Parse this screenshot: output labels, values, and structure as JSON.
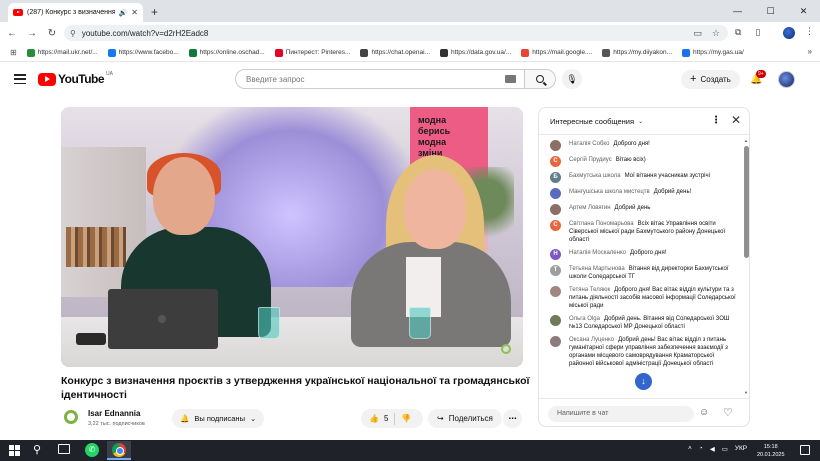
{
  "browser": {
    "tab_title": "(287) Конкурс з визначення...",
    "url": "youtube.com/watch?v=d2rH2Eadc8",
    "bookmarks": [
      {
        "label": "https://mail.ukr.net/...",
        "color": "#2a8c3a"
      },
      {
        "label": "https://www.facebo...",
        "color": "#1877f2"
      },
      {
        "label": "https://online.oschad...",
        "color": "#0b7a3a"
      },
      {
        "label": "Пинтерест: Pinteres...",
        "color": "#e60023"
      },
      {
        "label": "https://chat.openai...",
        "color": "#444444"
      },
      {
        "label": "https://data.gov.ua/...",
        "color": "#333333"
      },
      {
        "label": "https://mail.google....",
        "color": "#ea4335"
      },
      {
        "label": "https://my.diiyakon...",
        "color": "#555555"
      },
      {
        "label": "https://my.gas.ua/",
        "color": "#1a73e8"
      }
    ],
    "more_bookmarks": "»"
  },
  "youtube": {
    "logo_text": "YouTube",
    "region": "UA",
    "search_placeholder": "Введите запрос",
    "create_label": "Создать",
    "notif_badge": "9+"
  },
  "video": {
    "poster_lines": [
      "модна",
      "берись",
      "",
      "модна",
      "зміни"
    ],
    "title": "Конкурс з визначення проєктів з утвердження української національної та громадянської ідентичності",
    "channel_name": "Isar Ednannia",
    "channel_subs": "3,22 тыс. подписчиков",
    "subscribed_label": "Вы подписаны",
    "likes": "5",
    "share_label": "Поделиться"
  },
  "chat": {
    "header": "Интересные сообщения",
    "input_placeholder": "Напишите в чат",
    "messages": [
      {
        "author": "Наталія Собко",
        "text": "Доброго дня!",
        "initial": "",
        "color": "#8d6e63"
      },
      {
        "author": "Сергій Прудиус",
        "text": "Вітаю всіх)",
        "initial": "С",
        "color": "#e8663d"
      },
      {
        "author": "Бахмутська школа",
        "text": "Мої вітання учасникам зустрічі",
        "initial": "Б",
        "color": "#607d8b"
      },
      {
        "author": "Мангушська школа мистецтв",
        "text": "Добрий день!",
        "initial": "",
        "color": "#5c6bc0"
      },
      {
        "author": "Артем Ловягин",
        "text": "Добрий день",
        "initial": "",
        "color": "#8d6e63"
      },
      {
        "author": "Світлана Пономарьова",
        "text": "Всіх вітає Управління освіти Сіверської міської ради Бахмутського району Донецької області",
        "initial": "С",
        "color": "#e8663d"
      },
      {
        "author": "Наталія Москаленко",
        "text": "Доброго дня!",
        "initial": "Н",
        "color": "#7e57c2"
      },
      {
        "author": "Тетьяна Мартынова",
        "text": "Вітання від директорки Бахмутської школи Соледарської ТГ",
        "initial": "Т",
        "color": "#9e9e9e"
      },
      {
        "author": "Тетяна Теляюк",
        "text": "Доброго дня! Вас вітає відділ культури та з питань діяльності засобів масової інформації Соледарської міської ради",
        "initial": "",
        "color": "#a1887f"
      },
      {
        "author": "Ольга Olga",
        "text": "Добрий день. Вітання від Соледарської ЗОШ №13 Соледарської МР Донецької області",
        "initial": "",
        "color": "#6d7b5a"
      },
      {
        "author": "Оксана Луценко",
        "text": "Добрий день! Вас вітає відділ з питань гуманітарної сфери управління забезпечення взаємодії з органами місцевого самоврядування Краматорської районної військової адміністрації Донецької області",
        "initial": "",
        "color": "#8e7b7b"
      }
    ]
  },
  "taskbar": {
    "lang": "УКР",
    "time": "15:18",
    "date": "20.01.2025"
  }
}
